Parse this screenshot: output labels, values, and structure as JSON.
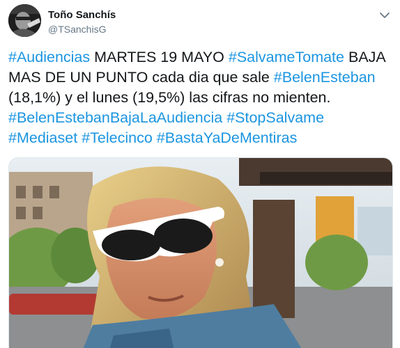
{
  "tweet": {
    "author": {
      "name": "Toño Sanchís",
      "handle": "@TSanchisG"
    },
    "text_lines": [
      [
        {
          "type": "hashtag",
          "text": "#Audiencias"
        },
        {
          "type": "text",
          "text": " MARTES 19 MAYO "
        },
        {
          "type": "hashtag",
          "text": "#SalvameTomate"
        },
        {
          "type": "text",
          "text": " BAJA"
        }
      ],
      [
        {
          "type": "text",
          "text": "MAS DE UN PUNTO cada dia que sale "
        },
        {
          "type": "hashtag",
          "text": "#BelenEsteban"
        }
      ],
      [
        {
          "type": "text",
          "text": "(18,1%) y el lunes (19,5%) las cifras no mienten."
        }
      ],
      [
        {
          "type": "hashtag",
          "text": "#BelenEstebanBajaLaAudiencia"
        },
        {
          "type": "text",
          "text": " "
        },
        {
          "type": "hashtag",
          "text": "#StopSalvame"
        }
      ],
      [
        {
          "type": "hashtag",
          "text": "#Mediaset"
        },
        {
          "type": "text",
          "text": " "
        },
        {
          "type": "hashtag",
          "text": "#Telecinco"
        },
        {
          "type": "text",
          "text": " "
        },
        {
          "type": "hashtag",
          "text": "#BastaYaDeMentiras"
        }
      ]
    ],
    "icons": {
      "avatar": "avatar-photo",
      "caret": "chevron-down-icon",
      "media": "photo-woman-sunglasses"
    },
    "colors": {
      "hashtag": "#1b95e0",
      "text": "#14171a",
      "handle": "#657786",
      "border": "#e1e8ed"
    }
  }
}
